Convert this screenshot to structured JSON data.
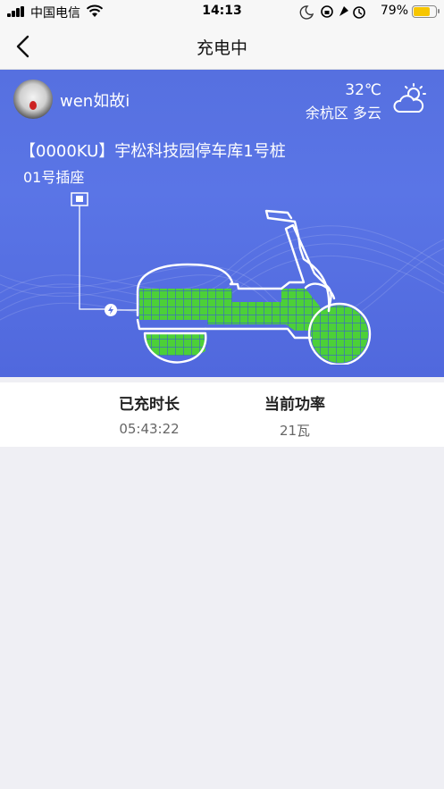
{
  "status_bar": {
    "carrier": "中国电信",
    "time": "14:13",
    "battery_percent": "79%",
    "battery_level": 0.79,
    "icons": [
      "signal-icon",
      "wifi-icon",
      "moon-icon",
      "rotation-lock-icon",
      "location-icon",
      "alarm-icon",
      "battery-icon"
    ]
  },
  "nav": {
    "title": "充电中",
    "back_icon": "chevron-left-icon"
  },
  "user": {
    "name": "wen如故i"
  },
  "weather": {
    "temperature": "32℃",
    "location_condition": "余杭区  多云",
    "icon": "partly-cloudy-icon"
  },
  "charger": {
    "station": "【0000KU】宇松科技园停车库1号桩",
    "socket": "01号插座"
  },
  "colors": {
    "hero_blue": "#5670e0",
    "battery_green": "#4cd038",
    "battery_yellow": "#f7c600"
  },
  "stats": {
    "duration_label": "已充时长",
    "duration_value": "05:43:22",
    "power_label": "当前功率",
    "power_value": "21瓦"
  }
}
